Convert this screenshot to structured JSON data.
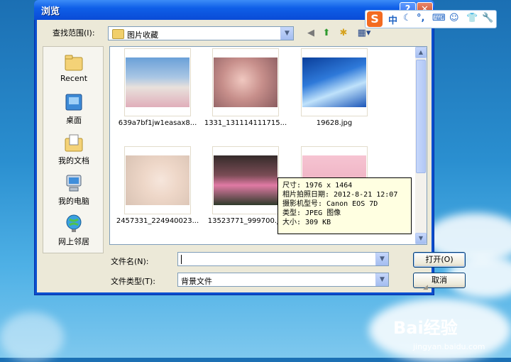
{
  "window": {
    "title": "浏览"
  },
  "toolbar": {
    "look_in_label": "查找范围(I):",
    "look_in_value": "图片收藏",
    "icons": [
      "back-icon",
      "up-folder-icon",
      "new-folder-icon",
      "views-menu-icon"
    ]
  },
  "places": [
    {
      "label": "Recent",
      "icon": "recent-folder-icon"
    },
    {
      "label": "桌面",
      "icon": "desktop-icon"
    },
    {
      "label": "我的文档",
      "icon": "my-documents-icon"
    },
    {
      "label": "我的电脑",
      "icon": "my-computer-icon"
    },
    {
      "label": "网上邻居",
      "icon": "network-icon"
    }
  ],
  "files": [
    {
      "name": "639a7bf1jw1easax8..."
    },
    {
      "name": "1331_131114111715..."
    },
    {
      "name": "19628.jpg"
    },
    {
      "name": "2457331_224940023..."
    },
    {
      "name": "13523771_999700.jp"
    },
    {
      "name": ""
    }
  ],
  "tooltip": {
    "size": "尺寸: 1976 x 1464",
    "date": "相片拍照日期: 2012-8-21 12:07",
    "camera": "摄影机型号: Canon EOS 7D",
    "type": "类型: JPEG 图像",
    "filesize": "大小: 309 KB"
  },
  "form": {
    "filename_label": "文件名(N):",
    "filename_value": "",
    "filetype_label": "文件类型(T):",
    "filetype_value": "背景文件",
    "open_label": "打开(O)",
    "cancel_label": "取消"
  },
  "ime_bar": {
    "logo": "S",
    "mode": "中",
    "items": [
      "moon-icon",
      "punctuation-icon",
      "keyboard-icon",
      "user-icon",
      "shirt-icon",
      "wrench-icon"
    ]
  },
  "watermark": {
    "logo": "Bai经验",
    "url": "jingyan.baidu.com"
  },
  "colors": {
    "title_bar": "#0a4bd6",
    "dialog_bg": "#ece9d8",
    "tooltip_bg": "#ffffe1",
    "ime_accent": "#f36b21"
  }
}
